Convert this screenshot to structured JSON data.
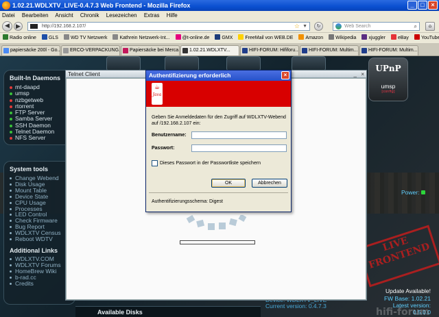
{
  "window": {
    "title": "1.02.21.WDLXTV_LIVE-0.4.7.3 Web Frontend - Mozilla Firefox",
    "buttons": [
      "_",
      "□",
      "×"
    ]
  },
  "menu": [
    "Datei",
    "Bearbeiten",
    "Ansicht",
    "Chronik",
    "Lesezeichen",
    "Extras",
    "Hilfe"
  ],
  "nav": {
    "url": "http://192.168.2.107/",
    "search_placeholder": "Web Search"
  },
  "bookmarks": [
    {
      "label": "Radio online",
      "color": "#2d7a2d"
    },
    {
      "label": "GLS",
      "color": "#1d4fa8"
    },
    {
      "label": "WD TV Netzwerk",
      "color": "#888888"
    },
    {
      "label": "Kathrein Netzwerk-Int...",
      "color": "#888888"
    },
    {
      "label": "@t-online.de",
      "color": "#e6007e"
    },
    {
      "label": "GMX",
      "color": "#1c3c7a"
    },
    {
      "label": "FreeMail von WEB.DE",
      "color": "#ffd200"
    },
    {
      "label": "Amazon",
      "color": "#f29100"
    },
    {
      "label": "Wikipedia",
      "color": "#777777"
    },
    {
      "label": "xjuggler",
      "color": "#5a2d82"
    },
    {
      "label": "eBay",
      "color": "#e53238"
    },
    {
      "label": "YouTube",
      "color": "#cc0000"
    }
  ],
  "tabs": [
    {
      "label": "papiersäcke 200l - Go...",
      "active": false,
      "color": "#4a8af4"
    },
    {
      "label": "ERCO-VERPACKUNG...",
      "active": false,
      "color": "#999999"
    },
    {
      "label": "Papiersäcke bei Merca...",
      "active": false,
      "color": "#c2185b"
    },
    {
      "label": "1.02.21.WDLXTV...",
      "active": true,
      "color": "#333333"
    },
    {
      "label": "HIFI-FORUM: Hififoru...",
      "active": false,
      "color": "#1f3d8a"
    },
    {
      "label": "HIFI-FORUM: Multim...",
      "active": false,
      "color": "#1f3d8a"
    },
    {
      "label": "HIFI-FORUM: Multim...",
      "active": false,
      "color": "#1f3d8a"
    }
  ],
  "daemons": {
    "title": "Built-In Daemons",
    "items": [
      {
        "label": "mt-daapd",
        "color": "#e03a3a"
      },
      {
        "label": "umsp",
        "color": "#3ac23a"
      },
      {
        "label": "nzbgetweb",
        "color": "#e03a3a"
      },
      {
        "label": "rtorrent",
        "color": "#e03a3a"
      },
      {
        "label": "FTP Server",
        "color": "#3ac23a"
      },
      {
        "label": "Samba Server",
        "color": "#3ac23a"
      },
      {
        "label": "SSH Daemon",
        "color": "#3ac23a"
      },
      {
        "label": "Telnet Daemon",
        "color": "#3ac23a"
      },
      {
        "label": "NFS Server",
        "color": "#e03a3a"
      }
    ]
  },
  "system_tools": {
    "title": "System tools",
    "items": [
      "Change Webend",
      "Disk Usage",
      "Mount Table",
      "Device State",
      "CPU Usage",
      "Processes",
      "LED Control",
      "Check Firmware",
      "Bug Report",
      "WDLXTV Census",
      "Reboot WDTV"
    ]
  },
  "additional_links": {
    "title": "Additional Links",
    "items": [
      "WDLXTV.COM",
      "WDLXTV Forums",
      "HomeBrew Wiki",
      "b-rad.cc",
      "Credits"
    ]
  },
  "upnp": {
    "logo": "UPnP",
    "name": "umsp",
    "config": "[config]"
  },
  "power": {
    "label": "Power:"
  },
  "stamp": {
    "line1": "LIVE",
    "line2": "FRONTEND"
  },
  "update": {
    "label": "Update Available!",
    "fw_base": "FW Base: 1.02.21",
    "latest": "Latest version: 0.5.0.0"
  },
  "device": {
    "label": "Device: WDLXTV_LIVE",
    "current": "Current version: 0.4.7.3"
  },
  "available_disks": "Available Disks",
  "watermark": "hifi-forum",
  "telnet": {
    "title": "Telnet Client",
    "buttons": [
      "_",
      "×"
    ]
  },
  "auth_dialog": {
    "title": "Authentifizierung erforderlich",
    "close": "×",
    "java_label": "Java",
    "message": "Geben Sie Anmeldedaten für den Zugriff auf WDLXTV-Webend auf /192.168.2.107 ein:",
    "username_label": "Benutzername:",
    "password_label": "Passwort:",
    "remember_label": "Dieses Passwort in der Passwortliste speichern",
    "ok": "OK",
    "cancel": "Abbrechen",
    "scheme": "Authentifizierungsschema: Digest"
  }
}
